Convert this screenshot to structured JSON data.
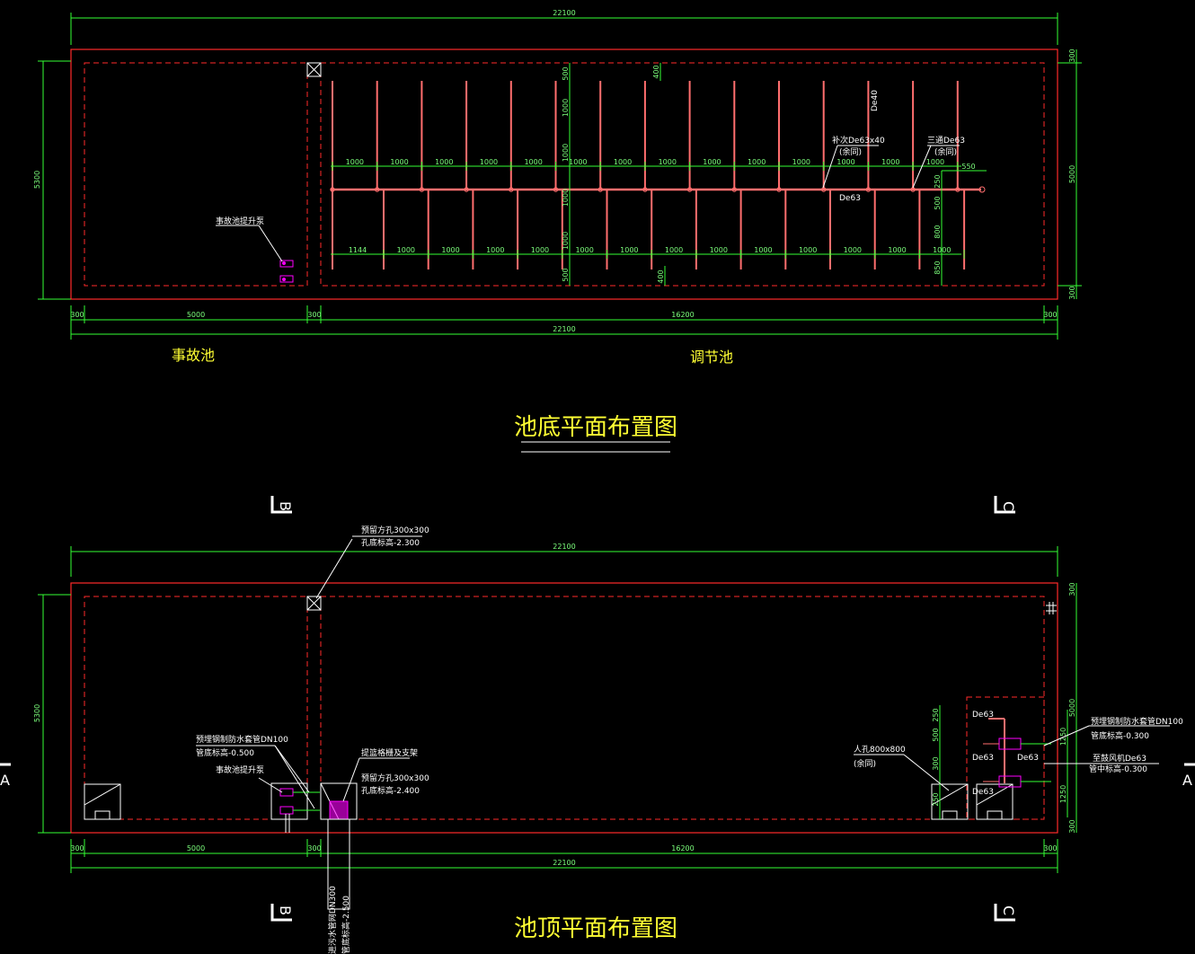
{
  "colors": {
    "background": "#000000",
    "wall": "#ff2a2a",
    "pipe": "#ff6e6e",
    "dimension": "#7cff7c",
    "title": "#ffff33",
    "pump": "#ff00ff",
    "annotation": "#ffffff"
  },
  "top_plan": {
    "title": "池底平面布置图",
    "overall_width": "22100",
    "height": "5300",
    "segments": [
      "300",
      "5000",
      "300",
      "16200",
      "300"
    ],
    "right_dims": [
      "300",
      "5000",
      "300"
    ],
    "accident_pool_label": "事故池",
    "regulating_pool_label": "调节池",
    "pump_label": "事故池提升泵",
    "pipe_main_label": "De63",
    "pipe_branch_label": "De40",
    "reducer_label": "补次De63x40",
    "reducer_note": "(余同)",
    "tee_label": "三通De63",
    "tee_note": "(余同)",
    "upper_spacings": [
      "1000",
      "1000",
      "1000",
      "1000",
      "1000",
      "1000",
      "1000",
      "1000",
      "1000",
      "1000",
      "1000",
      "1000",
      "1000",
      "1000"
    ],
    "lower_first_spacing": "1144",
    "lower_spacings": [
      "1000",
      "1000",
      "1000",
      "1000",
      "1000",
      "1000",
      "1000",
      "1000",
      "1000",
      "1000",
      "1000",
      "1000",
      "1000"
    ],
    "vertical_dims": [
      "500",
      "1000",
      "1000",
      "1000",
      "1000",
      "500"
    ],
    "mid_dim_top": "400",
    "mid_dim_bottom": "400",
    "right_end_dims": [
      "550",
      "250",
      "500",
      "800",
      "850"
    ]
  },
  "bottom_plan": {
    "title": "池顶平面布置图",
    "overall_width": "22100",
    "height": "5300",
    "segments": [
      "300",
      "5000",
      "300",
      "16200",
      "300"
    ],
    "right_dims": [
      "300",
      "5000",
      "300"
    ],
    "right_outer_dims": [
      "1250",
      "1250"
    ],
    "hole_label_1": "预留方孔300x300",
    "hole_elev_1": "孔底标高-2.300",
    "sleeve_label": "预埋钢制防水套管DN100",
    "sleeve_elev": "管底标高-0.500",
    "pump_label": "事故池提升泵",
    "grid_label": "提篮格栅及支架",
    "hole_label_2": "预留方孔300x300",
    "hole_elev_2": "孔底标高-2.400",
    "manhole_label": "人孔800x800",
    "manhole_note": "(余同)",
    "right_sleeve_label": "预埋钢制防水套管DN100",
    "right_sleeve_elev": "管底标高-0.300",
    "aeration_label": "至鼓风机De63",
    "aeration_elev": "管中标高-0.300",
    "inlet_label": "进污水管网DN300",
    "inlet_elev": "管底标高-2.500",
    "pipe_labels": [
      "De63",
      "De63",
      "De63",
      "De63"
    ],
    "small_dims": [
      "250",
      "500",
      "300",
      "250"
    ]
  },
  "section_marks": {
    "b": "B",
    "c": "C",
    "a": "A"
  }
}
